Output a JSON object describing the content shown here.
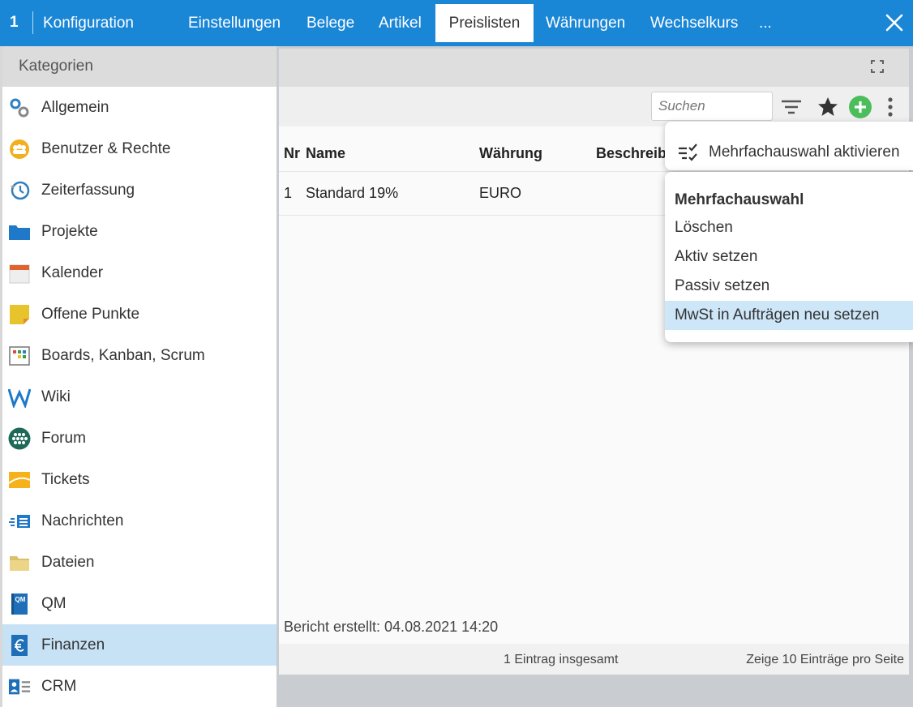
{
  "topbar": {
    "number": "1",
    "title": "Konfiguration",
    "tabs": [
      {
        "label": "Einstellungen"
      },
      {
        "label": "Belege"
      },
      {
        "label": "Artikel"
      },
      {
        "label": "Preislisten",
        "active": true
      },
      {
        "label": "Währungen"
      },
      {
        "label": "Wechselkurs"
      },
      {
        "label": "..."
      }
    ]
  },
  "sidebar": {
    "header": "Kategorien",
    "items": [
      {
        "label": "Allgemein",
        "icon": "gears-icon"
      },
      {
        "label": "Benutzer & Rechte",
        "icon": "users-icon"
      },
      {
        "label": "Zeiterfassung",
        "icon": "clock-icon"
      },
      {
        "label": "Projekte",
        "icon": "folder-icon"
      },
      {
        "label": "Kalender",
        "icon": "calendar-icon"
      },
      {
        "label": "Offene Punkte",
        "icon": "sticky-note-icon"
      },
      {
        "label": "Boards, Kanban, Scrum",
        "icon": "board-icon"
      },
      {
        "label": "Wiki",
        "icon": "wiki-icon"
      },
      {
        "label": "Forum",
        "icon": "forum-icon"
      },
      {
        "label": "Tickets",
        "icon": "ticket-icon"
      },
      {
        "label": "Nachrichten",
        "icon": "messages-icon"
      },
      {
        "label": "Dateien",
        "icon": "files-icon"
      },
      {
        "label": "QM",
        "icon": "qm-icon",
        "icon_text": "QM"
      },
      {
        "label": "Finanzen",
        "icon": "euro-icon",
        "active": true
      },
      {
        "label": "CRM",
        "icon": "crm-icon"
      }
    ]
  },
  "toolbar": {
    "search_placeholder": "Suchen"
  },
  "table": {
    "columns": [
      "Nr",
      "Name",
      "Währung",
      "Beschreib"
    ],
    "rows": [
      {
        "nr": "1",
        "name": "Standard 19%",
        "waehrung": "EURO"
      }
    ]
  },
  "report": "Bericht erstellt: 04.08.2021 14:20",
  "footer": {
    "total": "1 Eintrag insgesamt",
    "paging": "Zeige  10  Einträge pro Seite"
  },
  "menu": {
    "activate_multi": "Mehrfachauswahl aktivieren",
    "section_header": "Mehrfachauswahl",
    "items": [
      {
        "label": "Löschen"
      },
      {
        "label": "Aktiv setzen"
      },
      {
        "label": "Passiv setzen"
      },
      {
        "label": "MwSt in Aufträgen neu setzen",
        "highlighted": true
      }
    ]
  },
  "colors": {
    "topbar": "#1a86d6",
    "active_category": "#c7e2f5",
    "add_button": "#4cbd5b",
    "menu_highlight": "#cde6f8"
  }
}
